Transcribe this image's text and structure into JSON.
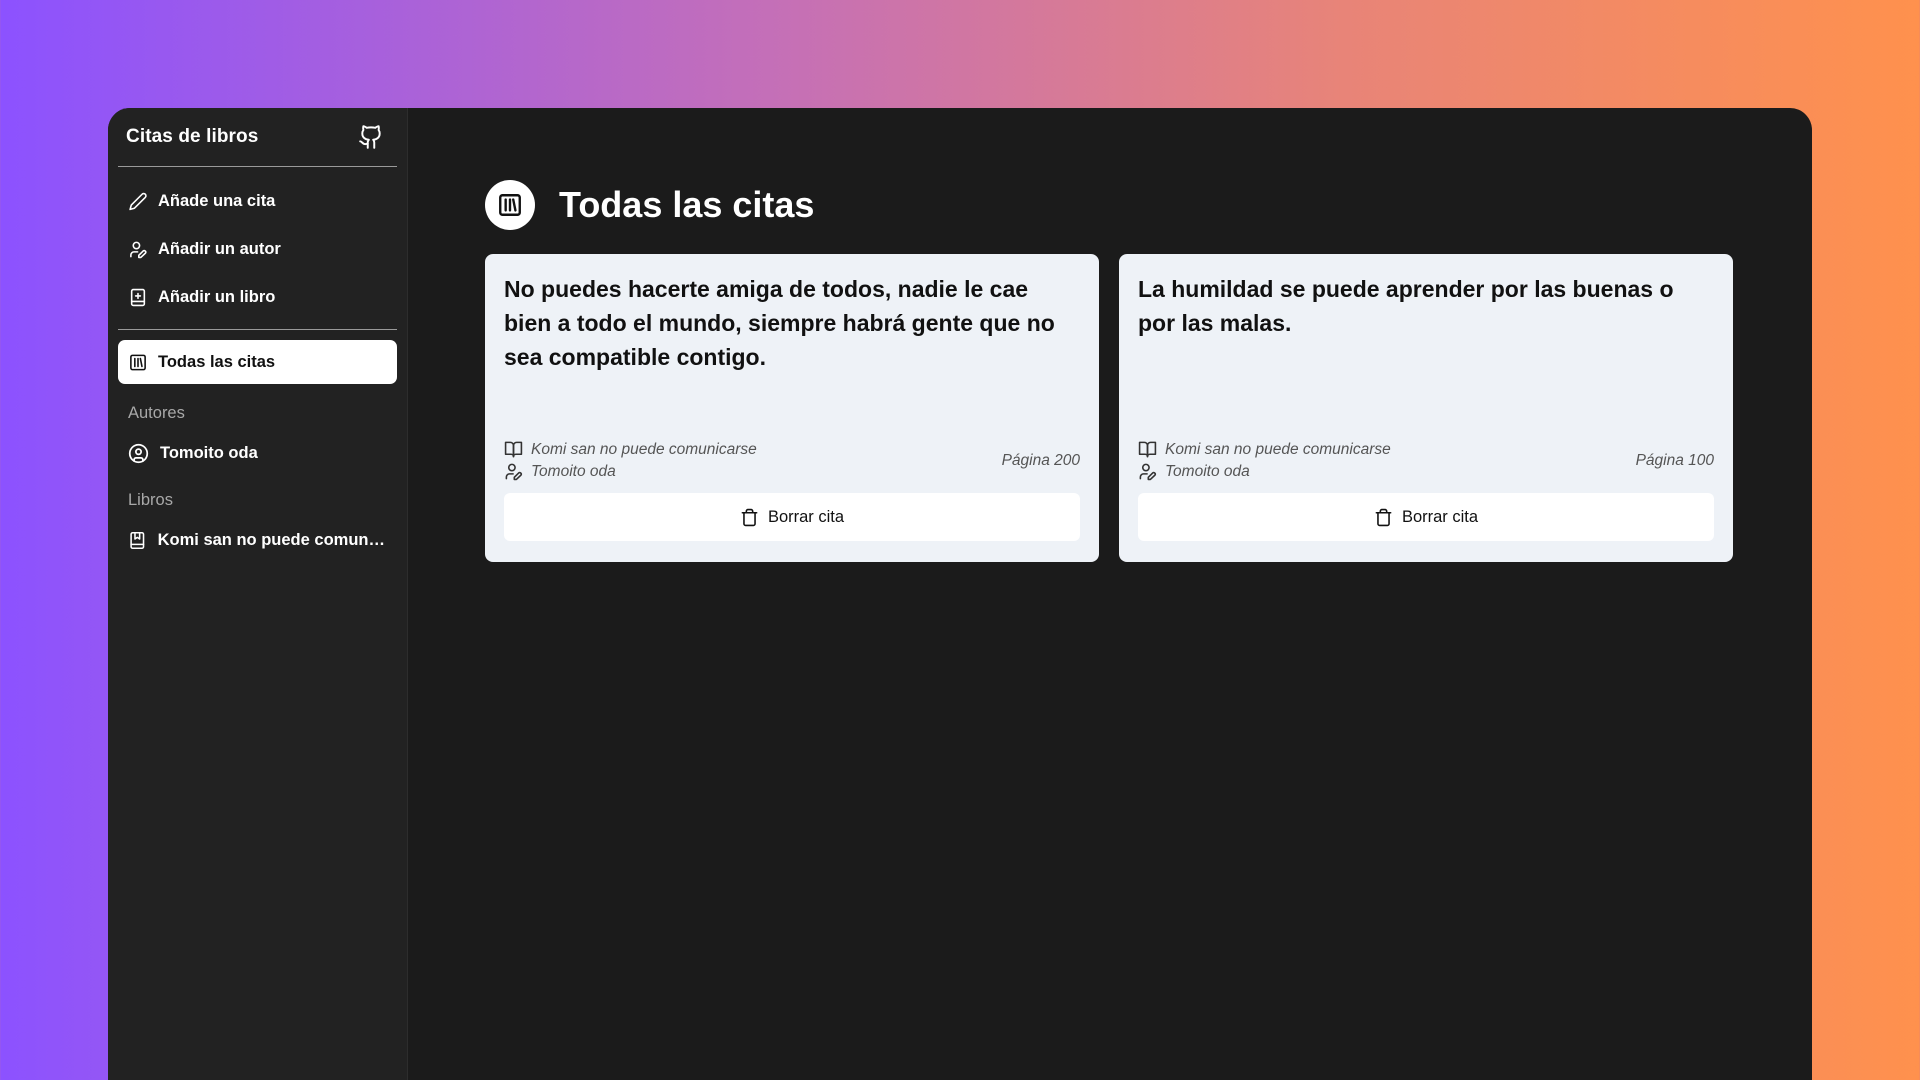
{
  "sidebar": {
    "title": "Citas de libros",
    "nav_items": [
      {
        "label": "Añade una cita",
        "icon": "pencil-icon"
      },
      {
        "label": "Añadir un autor",
        "icon": "user-pen-icon"
      },
      {
        "label": "Añadir un libro",
        "icon": "book-plus-icon"
      }
    ],
    "active_item": {
      "label": "Todas las citas",
      "icon": "library-icon"
    },
    "authors_label": "Autores",
    "authors": [
      {
        "label": "Tomoito oda",
        "icon": "user-circle-icon"
      }
    ],
    "books_label": "Libros",
    "books": [
      {
        "label": "Komi san no puede comunicarse",
        "icon": "book-bookmark-icon"
      }
    ]
  },
  "main": {
    "title": "Todas las citas",
    "quotes": [
      {
        "text": "No puedes hacerte amiga de todos, nadie le cae bien a todo el mundo, siempre habrá gente que no sea compatible contigo.",
        "book": "Komi san no puede comunicarse",
        "author": "Tomoito oda",
        "page": "Página 200",
        "delete_label": "Borrar cita"
      },
      {
        "text": "La humildad se puede aprender por las buenas o por las malas.",
        "book": "Komi san no puede comunicarse",
        "author": "Tomoito oda",
        "page": "Página 100",
        "delete_label": "Borrar cita"
      }
    ]
  },
  "colors": {
    "app_bg": "#1b1b1b",
    "sidebar_bg": "#222222",
    "card_bg": "#eef2f7"
  }
}
